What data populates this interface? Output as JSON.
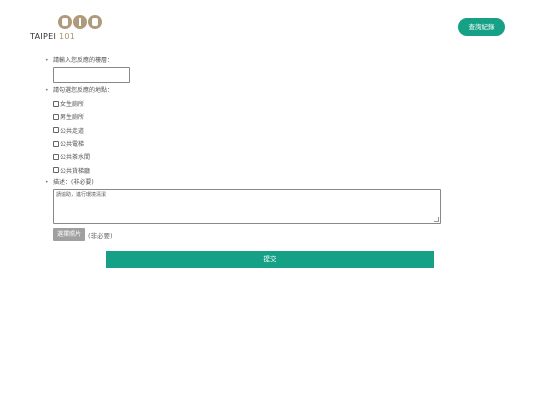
{
  "header": {
    "logo_text": "TAIPEI",
    "logo_number": "101",
    "history_button": "查詢紀錄"
  },
  "form": {
    "location_label": "請輸入您反應的樓層：",
    "location_value": "",
    "place_label": "請勾選您反應的地點：",
    "options": [
      "女生廁所",
      "男生廁所",
      "公共走道",
      "公共電梯",
      "公共茶水間",
      "公共貨梯廳"
    ],
    "description_label": "描述：(非必要)",
    "description_value": "請協助，進行環境清潔",
    "file_button": "選擇照片",
    "file_note": "(非必要)",
    "submit_button": "提交"
  },
  "colors": {
    "accent": "#16a085",
    "logo": "#b09a7c"
  }
}
